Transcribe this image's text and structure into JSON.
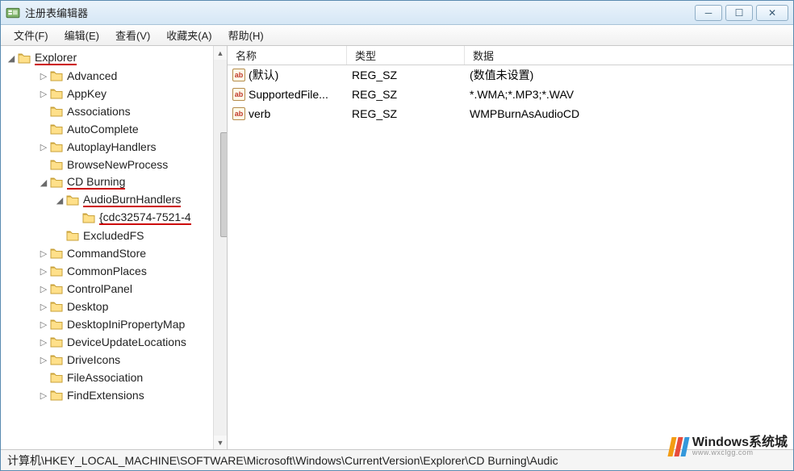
{
  "window": {
    "title": "注册表编辑器"
  },
  "menu": {
    "file": "文件(F)",
    "edit": "编辑(E)",
    "view": "查看(V)",
    "favorites": "收藏夹(A)",
    "help": "帮助(H)"
  },
  "tree": {
    "root": "Explorer",
    "items": [
      {
        "label": "Advanced",
        "indent": 2,
        "exp": "▷"
      },
      {
        "label": "AppKey",
        "indent": 2,
        "exp": "▷"
      },
      {
        "label": "Associations",
        "indent": 2,
        "exp": ""
      },
      {
        "label": "AutoComplete",
        "indent": 2,
        "exp": ""
      },
      {
        "label": "AutoplayHandlers",
        "indent": 2,
        "exp": "▷"
      },
      {
        "label": "BrowseNewProcess",
        "indent": 2,
        "exp": ""
      },
      {
        "label": "CD Burning",
        "indent": 2,
        "exp": "◢",
        "redline": true
      },
      {
        "label": "AudioBurnHandlers",
        "indent": 3,
        "exp": "◢",
        "redline": true
      },
      {
        "label": "{cdc32574-7521-4",
        "indent": 4,
        "exp": "",
        "redline": true
      },
      {
        "label": "ExcludedFS",
        "indent": 3,
        "exp": ""
      },
      {
        "label": "CommandStore",
        "indent": 2,
        "exp": "▷"
      },
      {
        "label": "CommonPlaces",
        "indent": 2,
        "exp": "▷"
      },
      {
        "label": "ControlPanel",
        "indent": 2,
        "exp": "▷"
      },
      {
        "label": "Desktop",
        "indent": 2,
        "exp": "▷"
      },
      {
        "label": "DesktopIniPropertyMap",
        "indent": 2,
        "exp": "▷"
      },
      {
        "label": "DeviceUpdateLocations",
        "indent": 2,
        "exp": "▷"
      },
      {
        "label": "DriveIcons",
        "indent": 2,
        "exp": "▷"
      },
      {
        "label": "FileAssociation",
        "indent": 2,
        "exp": ""
      },
      {
        "label": "FindExtensions",
        "indent": 2,
        "exp": "▷"
      }
    ]
  },
  "columns": {
    "name": "名称",
    "type": "类型",
    "data": "数据"
  },
  "rows": [
    {
      "name": "(默认)",
      "type": "REG_SZ",
      "data": "(数值未设置)"
    },
    {
      "name": "SupportedFile...",
      "type": "REG_SZ",
      "data": "*.WMA;*.MP3;*.WAV"
    },
    {
      "name": "verb",
      "type": "REG_SZ",
      "data": "WMPBurnAsAudioCD"
    }
  ],
  "statusbar": "计算机\\HKEY_LOCAL_MACHINE\\SOFTWARE\\Microsoft\\Windows\\CurrentVersion\\Explorer\\CD Burning\\Audic",
  "watermark": {
    "title": "Windows系统城",
    "sub": "www.wxclgg.com"
  },
  "icons": {
    "valtext": "ab"
  }
}
